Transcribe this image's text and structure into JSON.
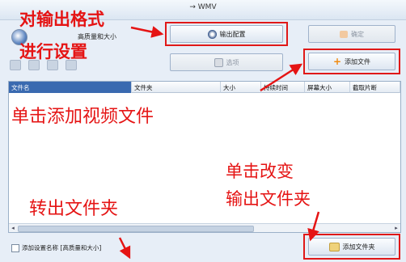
{
  "window": {
    "title": "→ WMV"
  },
  "profile": {
    "description": "高质量和大小"
  },
  "buttons": {
    "output_config": "输出配置",
    "confirm": "确定",
    "options": "选项",
    "add_file": "添加文件",
    "add_folder": "添加文件夹"
  },
  "table": {
    "columns": [
      {
        "label": "文件名"
      },
      {
        "label": "文件夹"
      },
      {
        "label": "大小"
      },
      {
        "label": "持续时间"
      },
      {
        "label": "屏幕大小"
      },
      {
        "label": "截取片断"
      }
    ]
  },
  "footer": {
    "add_settings_name": "添加设置名称",
    "preset": "[高质量和大小]"
  },
  "annotations": {
    "output_format_line1": "对输出格式",
    "output_format_line2": "进行设置",
    "add_video": "单击添加视频文件",
    "change_folder_line1": "单击改变",
    "change_folder_line2": "输出文件夹",
    "output_folder": "转出文件夹"
  },
  "colors": {
    "annotation": "#e51414",
    "selected_header": "#3a6ab0"
  }
}
